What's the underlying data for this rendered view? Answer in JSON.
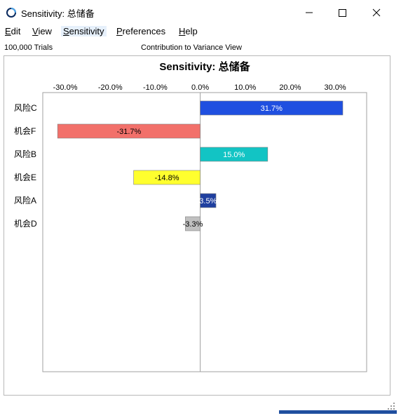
{
  "window": {
    "title": "Sensitivity: 总储备",
    "controls": [
      "minimize-icon",
      "maximize-icon",
      "close-icon"
    ]
  },
  "menu": {
    "items": [
      {
        "label": "Edit",
        "mnemonic": "E",
        "rest": "dit"
      },
      {
        "label": "View",
        "mnemonic": "V",
        "rest": "iew"
      },
      {
        "label": "Sensitivity",
        "mnemonic": "S",
        "rest": "ensitivity",
        "active": true
      },
      {
        "label": "Preferences",
        "mnemonic": "P",
        "rest": "references"
      },
      {
        "label": "Help",
        "mnemonic": "H",
        "rest": "elp"
      }
    ]
  },
  "info": {
    "trials": "100,000 Trials",
    "view": "Contribution to Variance View"
  },
  "chart_data": {
    "type": "bar",
    "orientation": "horizontal",
    "title": "Sensitivity: 总储备",
    "xlabel": "",
    "ylabel": "",
    "xlim": [
      -0.35,
      0.37
    ],
    "x_ticks": [
      -0.3,
      -0.2,
      -0.1,
      0.0,
      0.1,
      0.2,
      0.3
    ],
    "x_tick_labels": [
      "-30.0%",
      "-20.0%",
      "-10.0%",
      "0.0%",
      "10.0%",
      "20.0%",
      "30.0%"
    ],
    "grid": false,
    "categories": [
      "风险C",
      "机会F",
      "风险B",
      "机会E",
      "风险A",
      "机会D"
    ],
    "values": [
      0.317,
      -0.317,
      0.15,
      -0.148,
      0.035,
      -0.033
    ],
    "value_labels": [
      "31.7%",
      "-31.7%",
      "15.0%",
      "-14.8%",
      "3.5%",
      "-3.3%"
    ],
    "colors": [
      "#1f4fe0",
      "#f2706a",
      "#12c4c4",
      "#ffff2e",
      "#1f3f9f",
      "#c0c0c0"
    ],
    "label_colors": [
      "#ffffff",
      "#000000",
      "#ffffff",
      "#000000",
      "#ffffff",
      "#000000"
    ]
  }
}
